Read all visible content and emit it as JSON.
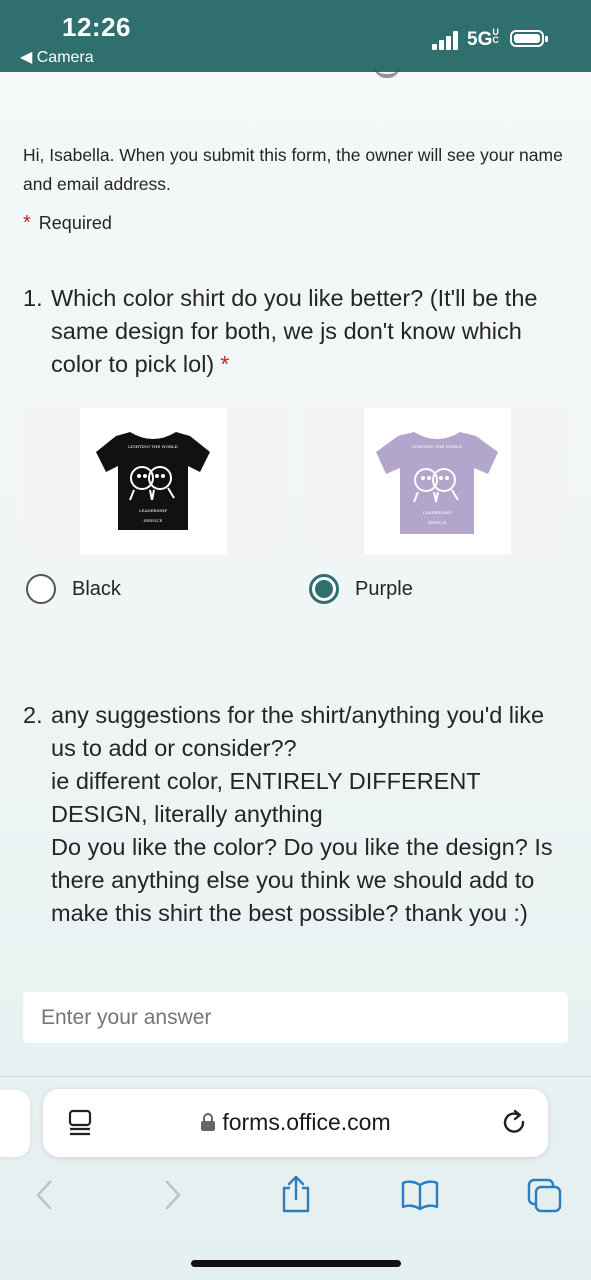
{
  "status_bar": {
    "time": "12:26",
    "back_label": "◀ Camera",
    "network": "5G",
    "network_sup": "UC"
  },
  "form": {
    "intro": "Hi, Isabella. When you submit this form, the owner will see your name and email address.",
    "required_label": "Required",
    "questions": [
      {
        "number": "1.",
        "text": "Which color shirt do you like better? (It'll be the same design for both, we js don't know which color to pick lol)",
        "required": true,
        "options": [
          {
            "label": "Black",
            "selected": false,
            "shirt_color": "#111111"
          },
          {
            "label": "Purple",
            "selected": true,
            "shirt_color": "#b3a6cc"
          }
        ]
      },
      {
        "number": "2.",
        "text_lines": [
          "any suggestions for the shirt/anything you'd like us to add or consider??",
          "ie different color, ENTIRELY DIFFERENT DESIGN, literally anything",
          "Do you like the color? Do you like the design? Is there anything else you think we should add to make this shirt the best possible? thank you :)"
        ],
        "placeholder": "Enter your answer"
      }
    ]
  },
  "browser": {
    "url": "forms.office.com"
  },
  "colors": {
    "accent": "#2f6f6e",
    "required_star": "#c4262e"
  }
}
